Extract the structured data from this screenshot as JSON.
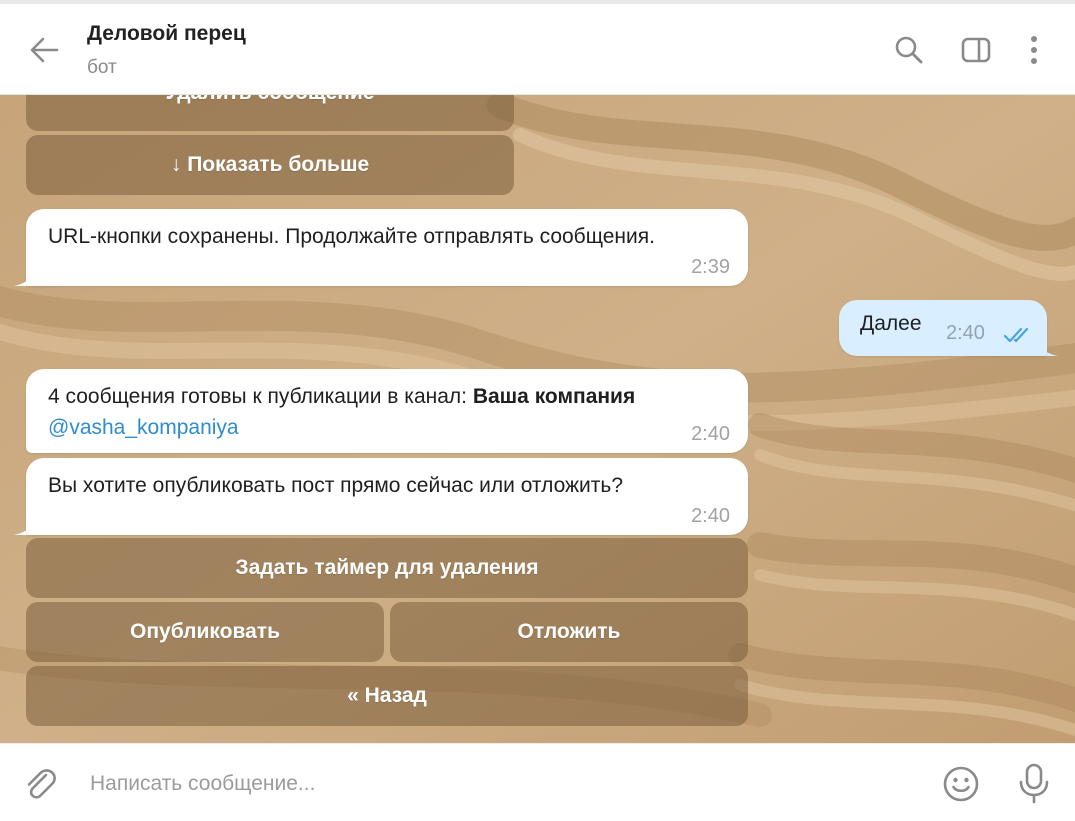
{
  "header": {
    "title": "Деловой перец",
    "subtitle": "бот"
  },
  "icons": {
    "back": "arrow-left-icon",
    "search": "search-icon",
    "side_panel": "side-panel-icon",
    "more": "more-vertical-icon",
    "attach": "paperclip-icon",
    "emoji": "smile-icon",
    "mic": "microphone-icon",
    "read_status": "double-check-icon"
  },
  "colors": {
    "outgoing_bubble": "#d9efff",
    "incoming_bubble": "#ffffff",
    "link": "#2e8ccf",
    "read_ticks": "#4aa3df",
    "keyboard_button": "#6e5432"
  },
  "keyboard_top": {
    "delete_message": "Удалить сообщение",
    "show_more": "↓ Показать больше"
  },
  "messages": [
    {
      "direction": "incoming",
      "text": "URL-кнопки сохранены. Продолжайте отправлять сообщения.",
      "time": "2:39"
    },
    {
      "direction": "outgoing",
      "text": "Далее",
      "time": "2:40",
      "status": "read"
    },
    {
      "direction": "incoming",
      "text": "4 сообщения готовы к публикации в канал: ",
      "channel": "Ваша компания",
      "link": "@vasha_kompaniya",
      "time": "2:40"
    },
    {
      "direction": "incoming",
      "text": "Вы хотите опубликовать пост прямо сейчас или отложить?",
      "time": "2:40"
    }
  ],
  "keyboard_bottom": {
    "set_timer": "Задать таймер для удаления",
    "publish": "Опубликовать",
    "postpone": "Отложить",
    "back": "« Назад"
  },
  "composer": {
    "placeholder": "Написать сообщение..."
  }
}
